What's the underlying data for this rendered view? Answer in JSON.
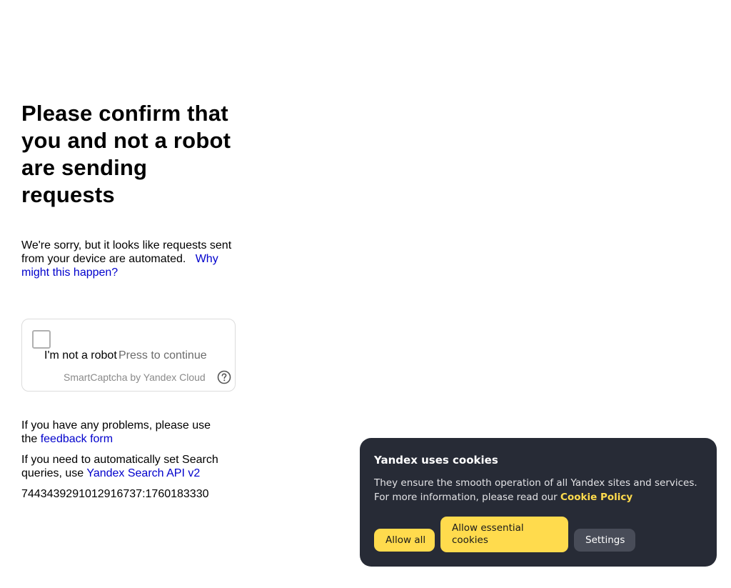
{
  "page": {
    "title": "Please confirm that you and not a robot are sending requests",
    "apology": "We're sorry, but it looks like requests sent from your device are automated.",
    "why_link": "Why might this happen?"
  },
  "captcha": {
    "checkbox_label": "I'm not a robot",
    "press_text": "Press to continue",
    "brand": "SmartCaptcha by Yandex Cloud",
    "help_icon": "question-circle-icon"
  },
  "info": {
    "problems_prefix": "If you have any problems, please use the",
    "feedback_link": "feedback form",
    "api_prefix": "If you need to automatically set Search queries, use",
    "api_link": "Yandex Search API v2",
    "token": "7443439291012916737:1760183330"
  },
  "cookie": {
    "title": "Yandex uses cookies",
    "text": "They ensure the smooth operation of all Yandex sites and services. For more information, please read our",
    "policy_link": "Cookie Policy",
    "allow_all": "Allow all",
    "allow_essential": "Allow essential cookies",
    "settings": "Settings"
  },
  "colors": {
    "link": "#0000cc",
    "accent": "#ffdb4d",
    "banner_bg": "#272b36"
  }
}
